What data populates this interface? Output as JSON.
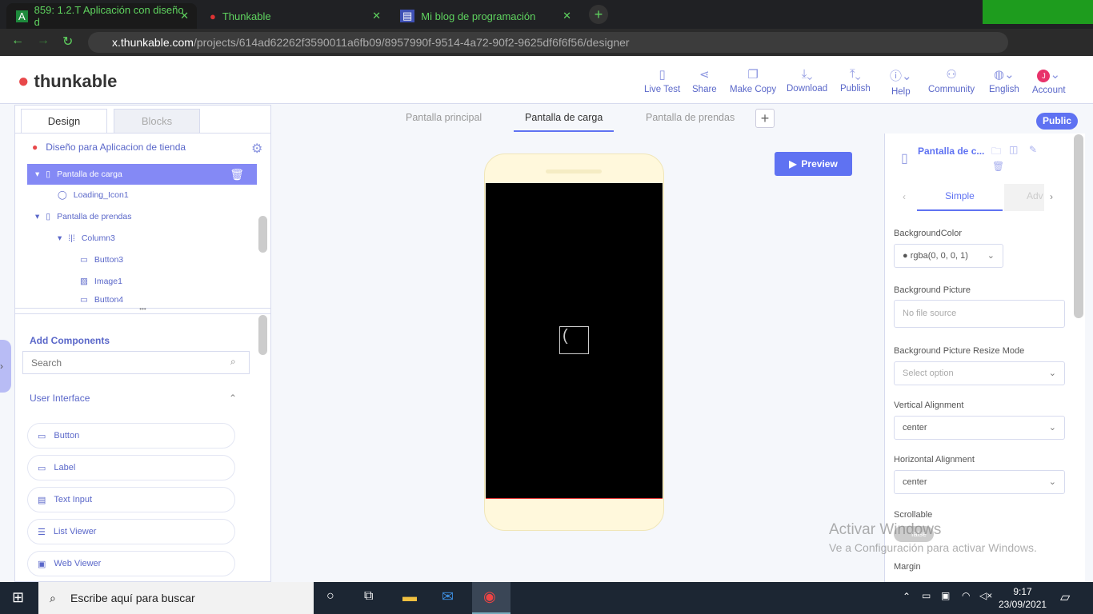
{
  "browser": {
    "tabs": [
      {
        "title": "859: 1.2.T Aplicación con diseño d"
      },
      {
        "title": "Thunkable"
      },
      {
        "title": "Mi blog de programación"
      }
    ],
    "url_host": "x.thunkable.com",
    "url_path": "/projects/614ad62262f3590011a6fb09/8957990f-9514-4a72-90f2-9625df6f6f56/designer"
  },
  "header": {
    "logo": "thunkable",
    "tools": [
      {
        "label": "Live Test",
        "icon": "phone-icon"
      },
      {
        "label": "Share",
        "icon": "share-icon"
      },
      {
        "label": "Make Copy",
        "icon": "copy-icon"
      },
      {
        "label": "Download",
        "icon": "download-icon"
      },
      {
        "label": "Publish",
        "icon": "upload-icon"
      },
      {
        "label": "Help",
        "icon": "info-icon"
      },
      {
        "label": "Community",
        "icon": "community-icon"
      },
      {
        "label": "English",
        "icon": "globe-icon"
      },
      {
        "label": "Account",
        "icon": "avatar",
        "avatar": "J"
      }
    ]
  },
  "left": {
    "tabs": [
      "Design",
      "Blocks"
    ],
    "project": "Diseño para Aplicacion de tienda",
    "tree": [
      "Pantalla de carga",
      "Loading_Icon1",
      "Pantalla de prendas",
      "Column3",
      "Button3",
      "Image1",
      "Button4"
    ],
    "add_components": "Add Components",
    "search_placeholder": "Search",
    "section": "User Interface",
    "components": [
      "Button",
      "Label",
      "Text Input",
      "List Viewer",
      "Web Viewer"
    ]
  },
  "screens": {
    "tabs": [
      "Pantalla principal",
      "Pantalla de carga",
      "Pantalla de prendas"
    ],
    "active": "Pantalla de carga",
    "public": "Public"
  },
  "canvas": {
    "preview": "Preview"
  },
  "props": {
    "title": "Pantalla de c...",
    "tabs": [
      "Simple",
      "Adv"
    ],
    "bg_color_label": "BackgroundColor",
    "bg_color": "rgba(0, 0, 0, 1)",
    "bg_picture_label": "Background Picture",
    "bg_picture": "No file source",
    "resize_label": "Background Picture Resize Mode",
    "resize": "Select option",
    "valign_label": "Vertical Alignment",
    "valign": "center",
    "halign_label": "Horizontal Alignment",
    "halign": "center",
    "scroll_label": "Scrollable",
    "scroll": "false",
    "margin_label": "Margin"
  },
  "watermark": {
    "line1": "Activar Windows",
    "line2": "Ve a Configuración para activar Windows."
  },
  "taskbar": {
    "search": "Escribe aquí para buscar",
    "time": "9:17",
    "date": "23/09/2021"
  },
  "colors": {
    "accent": "#5a67c9",
    "selected": "#8489f5",
    "public": "#5f72f2"
  }
}
